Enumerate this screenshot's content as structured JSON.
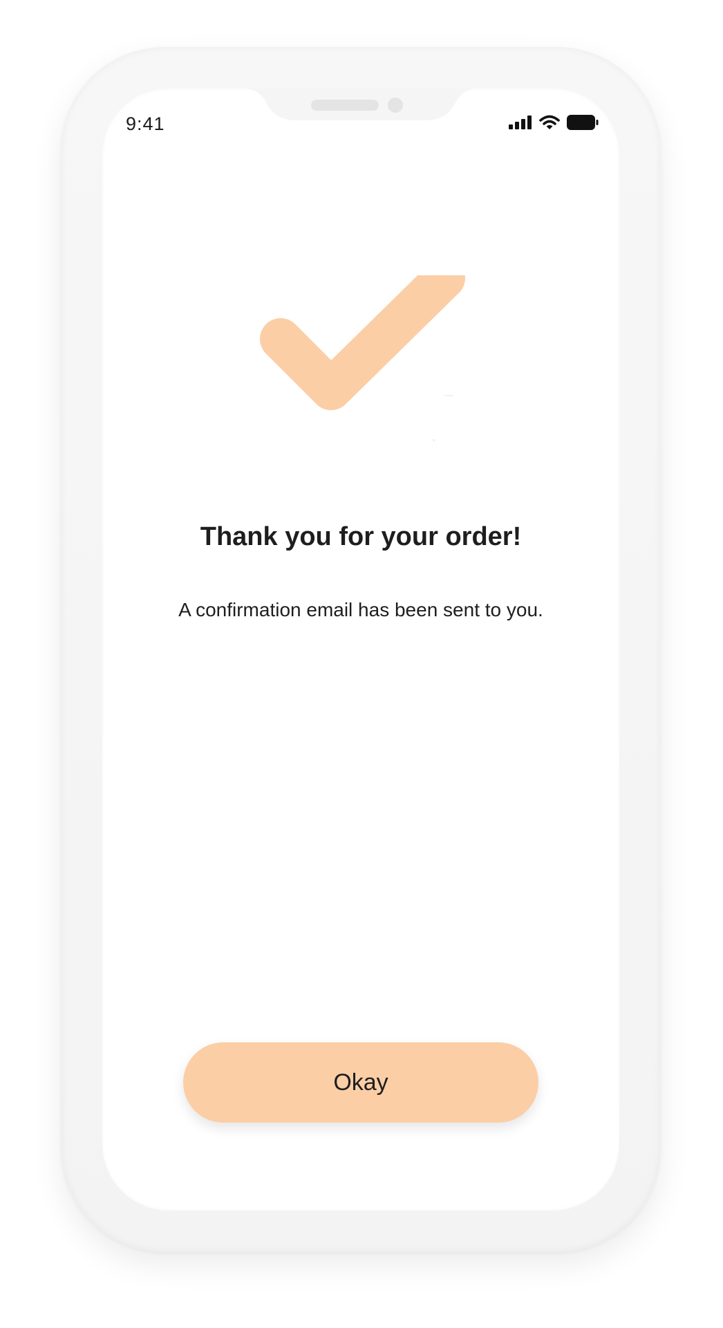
{
  "status_bar": {
    "time": "9:41",
    "icons": [
      "cellular-signal-icon",
      "wifi-icon",
      "battery-icon"
    ]
  },
  "confirmation": {
    "icon": "checkmark-icon",
    "title": "Thank you for your order!",
    "message": "A confirmation email has been sent to you."
  },
  "actions": {
    "okay_label": "Okay"
  },
  "colors": {
    "accent": "#fbcea6",
    "text": "#1e1e1e",
    "device_frame": "#f5f5f5",
    "screen": "#ffffff"
  }
}
